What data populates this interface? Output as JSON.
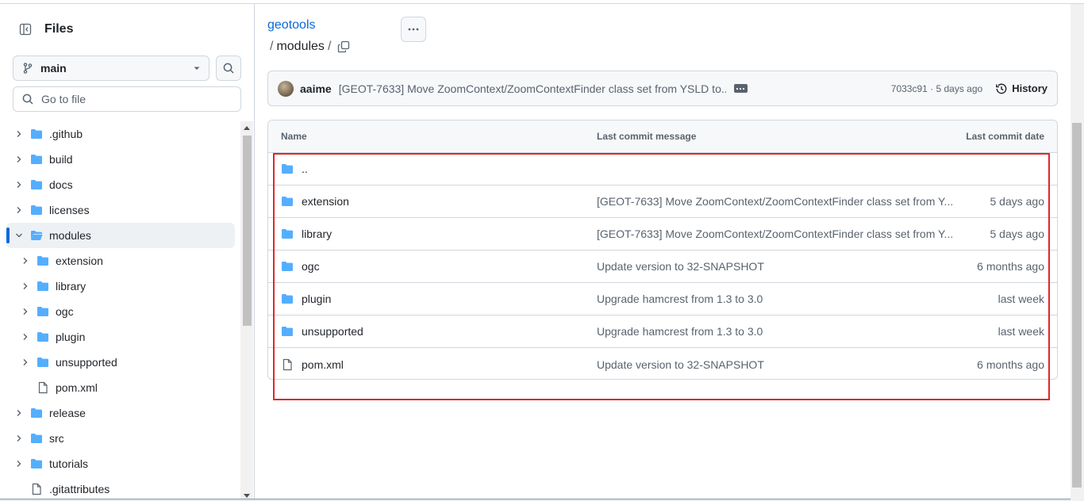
{
  "sidebar": {
    "title": "Files",
    "branch": "main",
    "goto_placeholder": "Go to file",
    "tree": [
      {
        "label": ".github",
        "type": "folder",
        "depth": 0,
        "expanded": false
      },
      {
        "label": "build",
        "type": "folder",
        "depth": 0,
        "expanded": false
      },
      {
        "label": "docs",
        "type": "folder",
        "depth": 0,
        "expanded": false
      },
      {
        "label": "licenses",
        "type": "folder",
        "depth": 0,
        "expanded": false
      },
      {
        "label": "modules",
        "type": "folder-open",
        "depth": 0,
        "expanded": true,
        "active": true
      },
      {
        "label": "extension",
        "type": "folder",
        "depth": 1,
        "expanded": false
      },
      {
        "label": "library",
        "type": "folder",
        "depth": 1,
        "expanded": false
      },
      {
        "label": "ogc",
        "type": "folder",
        "depth": 1,
        "expanded": false
      },
      {
        "label": "plugin",
        "type": "folder",
        "depth": 1,
        "expanded": false
      },
      {
        "label": "unsupported",
        "type": "folder",
        "depth": 1,
        "expanded": false
      },
      {
        "label": "pom.xml",
        "type": "file",
        "depth": 1
      },
      {
        "label": "release",
        "type": "folder",
        "depth": 0,
        "expanded": false
      },
      {
        "label": "src",
        "type": "folder",
        "depth": 0,
        "expanded": false
      },
      {
        "label": "tutorials",
        "type": "folder",
        "depth": 0,
        "expanded": false
      },
      {
        "label": ".gitattributes",
        "type": "file",
        "depth": 0
      }
    ]
  },
  "breadcrumb": {
    "repo": "geotools",
    "sep1": "/",
    "current": "modules",
    "sep2": "/"
  },
  "commit": {
    "author": "aaime",
    "message": "[GEOT-7633] Move ZoomContext/ZoomContextFinder class set from YSLD to...",
    "sha_time": "7033c91 · 5 days ago",
    "history_label": "History"
  },
  "table": {
    "headers": {
      "name": "Name",
      "message": "Last commit message",
      "date": "Last commit date"
    },
    "parent": "..",
    "rows": [
      {
        "name": "extension",
        "type": "folder",
        "message": "[GEOT-7633] Move ZoomContext/ZoomContextFinder class set from Y...",
        "date": "5 days ago"
      },
      {
        "name": "library",
        "type": "folder",
        "message": "[GEOT-7633] Move ZoomContext/ZoomContextFinder class set from Y...",
        "date": "5 days ago"
      },
      {
        "name": "ogc",
        "type": "folder",
        "message": "Update version to 32-SNAPSHOT",
        "date": "6 months ago"
      },
      {
        "name": "plugin",
        "type": "folder",
        "message": "Upgrade hamcrest from 1.3 to 3.0",
        "date": "last week"
      },
      {
        "name": "unsupported",
        "type": "folder",
        "message": "Upgrade hamcrest from 1.3 to 3.0",
        "date": "last week"
      },
      {
        "name": "pom.xml",
        "type": "file",
        "message": "Update version to 32-SNAPSHOT",
        "date": "6 months ago"
      }
    ]
  },
  "colors": {
    "accent": "#0969da",
    "folder": "#54aeff",
    "highlight": "#e0262a"
  }
}
